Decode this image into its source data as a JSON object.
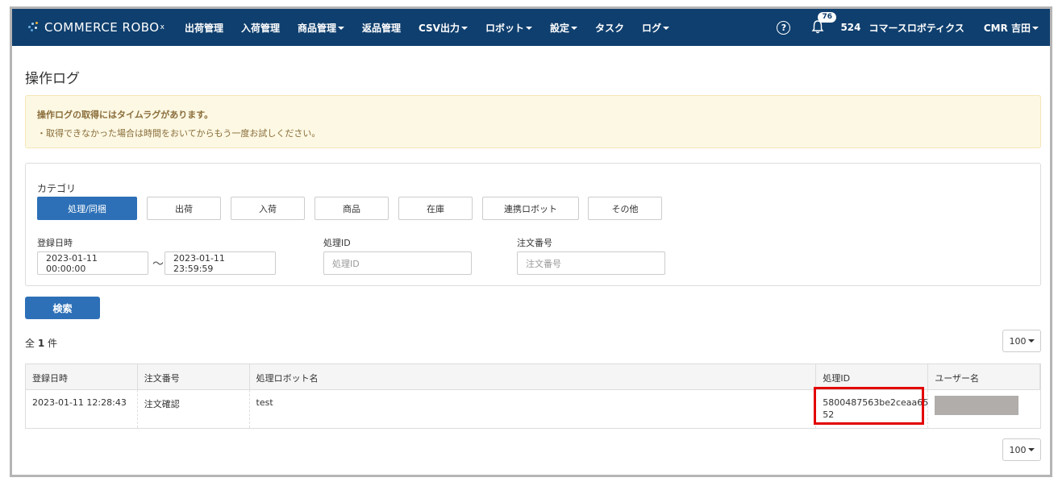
{
  "brand": {
    "name": "COMMERCE ROBO",
    "sup": "x"
  },
  "nav": {
    "items": [
      {
        "label": "出荷管理",
        "dropdown": false
      },
      {
        "label": "入荷管理",
        "dropdown": false
      },
      {
        "label": "商品管理",
        "dropdown": true
      },
      {
        "label": "返品管理",
        "dropdown": false
      },
      {
        "label": "CSV出力",
        "dropdown": true
      },
      {
        "label": "ロボット",
        "dropdown": true
      },
      {
        "label": "設定",
        "dropdown": true
      },
      {
        "label": "タスク",
        "dropdown": false
      },
      {
        "label": "ログ",
        "dropdown": true
      }
    ],
    "help_icon": "question-circle-icon",
    "notification_count": "76",
    "count": "524",
    "company": "コマースロボティクス",
    "user": "CMR 吉田"
  },
  "page": {
    "title": "操作ログ"
  },
  "alert": {
    "title": "操作ログの取得にはタイムラグがあります。",
    "body": "・取得できなかった場合は時間をおいてからもう一度お試しください。"
  },
  "filters": {
    "category_label": "カテゴリ",
    "categories": [
      "処理/同梱",
      "出荷",
      "入荷",
      "商品",
      "在庫",
      "連携ロボット",
      "その他"
    ],
    "active_category": "処理/同梱",
    "date_label": "登録日時",
    "date_from": "2023-01-11 00:00:00",
    "date_sep": "〜",
    "date_to": "2023-01-11 23:59:59",
    "process_id_label": "処理ID",
    "process_id_placeholder": "処理ID",
    "order_no_label": "注文番号",
    "order_no_placeholder": "注文番号",
    "search_label": "検索"
  },
  "results": {
    "total_prefix": "全",
    "total_count": "1",
    "total_suffix": "件",
    "page_size": "100"
  },
  "table": {
    "headers": [
      "登録日時",
      "注文番号",
      "処理ロボット名",
      "処理ID",
      "ユーザー名"
    ],
    "rows": [
      {
        "registered_at": "2023-01-11 12:28:43",
        "order_no": "注文確認",
        "robot_name": "test",
        "process_id_line1": "5800487563be2ceaa65",
        "process_id_line2": "52",
        "user_name_redacted": true
      }
    ]
  }
}
